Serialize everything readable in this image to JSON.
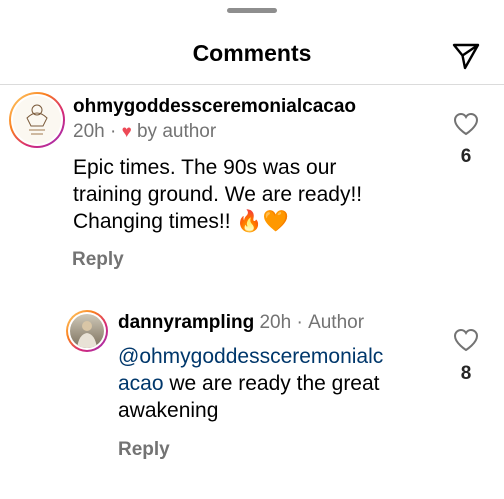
{
  "header": {
    "title": "Comments"
  },
  "comment": {
    "username": "ohmygoddessceremonialcacao",
    "time": "20h",
    "separator": "·",
    "liked_by": "by author",
    "text_line1": "Epic times. The 90s was our",
    "text_line2": "training ground. We are ready!!",
    "text_line3": "Changing times!! 🔥🧡",
    "reply_label": "Reply",
    "likes": "6"
  },
  "reply": {
    "username": "dannyrampling",
    "time": "20h",
    "separator": "·",
    "badge": "Author",
    "mention_line1": "@ohmygoddessceremonialc",
    "mention_line2": "acao",
    "text_line2": " we are ready the great",
    "text_line3": "awakening",
    "reply_label": "Reply",
    "likes": "8"
  },
  "colors": {
    "heart": "#ed4956",
    "mention": "#00376b",
    "muted": "#737373"
  }
}
